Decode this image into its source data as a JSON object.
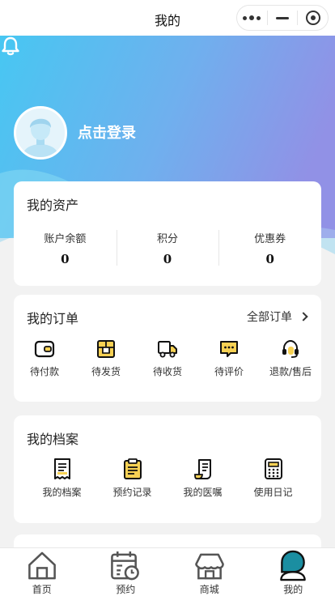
{
  "topbar": {
    "title": "我的"
  },
  "colors": {
    "hero_left": "#48c6ef",
    "hero_right": "#8f94e8",
    "icon_yellow": "#f7d154",
    "tab_active": "#1b8ea1"
  },
  "profile": {
    "login_text": "点击登录"
  },
  "assets": {
    "title": "我的资产",
    "items": [
      {
        "label": "账户余额",
        "value": "0"
      },
      {
        "label": "积分",
        "value": "0"
      },
      {
        "label": "优惠券",
        "value": "0"
      }
    ]
  },
  "orders": {
    "title": "我的订单",
    "all_label": "全部订单",
    "items": [
      {
        "label": "待付款",
        "icon": "wallet-icon"
      },
      {
        "label": "待发货",
        "icon": "package-icon"
      },
      {
        "label": "待收货",
        "icon": "truck-icon"
      },
      {
        "label": "待评价",
        "icon": "comment-icon"
      },
      {
        "label": "退款/售后",
        "icon": "headset-icon"
      }
    ]
  },
  "records": {
    "title": "我的档案",
    "items": [
      {
        "label": "我的档案",
        "icon": "file-icon"
      },
      {
        "label": "预约记录",
        "icon": "clipboard-icon"
      },
      {
        "label": "我的医嘱",
        "icon": "scroll-icon"
      },
      {
        "label": "使用日记",
        "icon": "calculator-icon"
      }
    ]
  },
  "tabbar": {
    "items": [
      {
        "label": "首页",
        "icon": "home-icon"
      },
      {
        "label": "预约",
        "icon": "calendar-icon"
      },
      {
        "label": "商城",
        "icon": "shop-icon"
      },
      {
        "label": "我的",
        "icon": "user-icon",
        "active": true
      }
    ]
  }
}
